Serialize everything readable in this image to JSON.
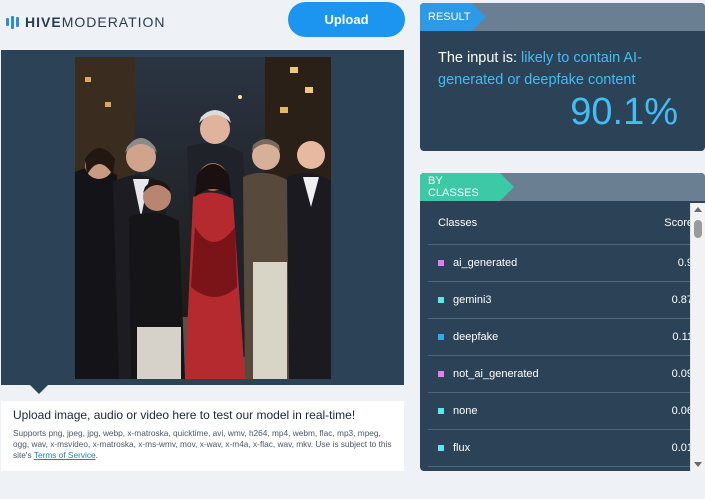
{
  "brand": {
    "bold": "HIVE",
    "rest": "MODERATION",
    "icon": "hive-bars-logo-icon"
  },
  "upload_button": "Upload",
  "upload_info": {
    "headline": "Upload image, audio or video here to test our model in real-time!",
    "formats": "Supports png, jpeg, jpg, webp, x-matroska, quicktime, avi, wmv, h264, mp4, webm, flac, mp3, mpeg, ogg, wav, x-msvideo, x-matroska, x-ms-wmv, mov, x-wav, x-m4a, x-flac, wav, mkv. Use is subject to this site's ",
    "terms_link": "Terms of Service",
    "terms_suffix": "."
  },
  "result": {
    "tab": "RESULT",
    "prefix": "The input is: ",
    "verdict": "likely to contain AI-generated or deepfake content",
    "percentage": "90.1%"
  },
  "classes": {
    "tab": "BY CLASSES",
    "header_class": "Classes",
    "header_score": "Score",
    "rows": [
      {
        "name": "ai_generated",
        "score": "0.9",
        "color": "#e27ef0"
      },
      {
        "name": "gemini3",
        "score": "0.87",
        "color": "#5ee6ee"
      },
      {
        "name": "deepfake",
        "score": "0.11",
        "color": "#33aaf0"
      },
      {
        "name": "not_ai_generated",
        "score": "0.09",
        "color": "#e27ef0"
      },
      {
        "name": "none",
        "score": "0.06",
        "color": "#5ee6ee"
      },
      {
        "name": "flux",
        "score": "0.01",
        "color": "#5ee6ee"
      }
    ]
  },
  "colors": {
    "panel": "#2b4257",
    "accent_blue": "#1b95f0",
    "result_highlight": "#42bdf5",
    "tab_result": "#2c9ae6",
    "tab_classes": "#3cc9a6"
  }
}
